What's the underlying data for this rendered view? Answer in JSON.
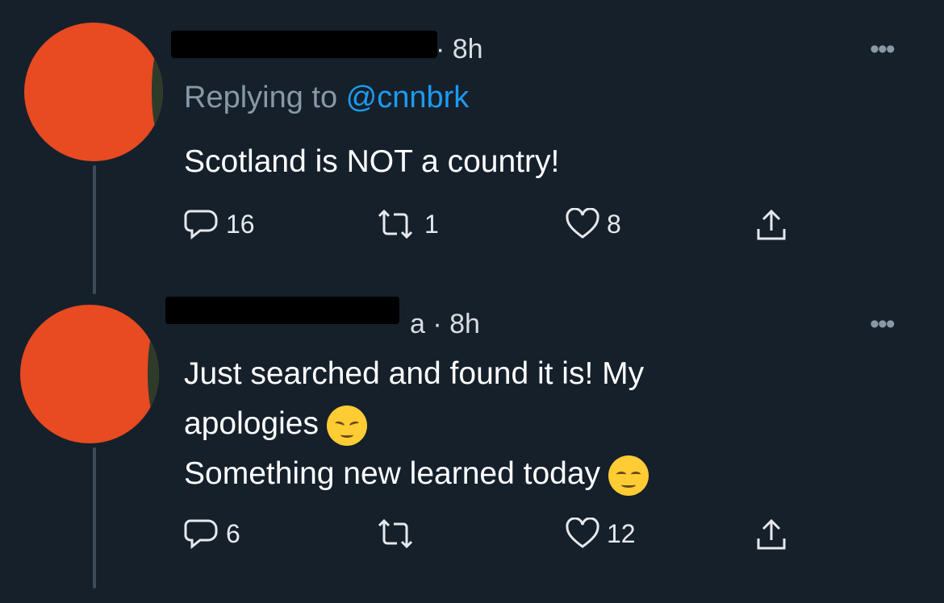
{
  "tweets": [
    {
      "time": "· 8h",
      "replying_prefix": "Replying to ",
      "replying_handle": "@cnnbrk",
      "text_lines": [
        "Scotland is NOT a country!"
      ],
      "reply_count": "16",
      "retweet_count": "1",
      "like_count": "8",
      "more": "•••"
    },
    {
      "time": "a · 8h",
      "text_lines": [
        "Just searched and found it is! My",
        "apologies",
        "Something new learned today"
      ],
      "emojis": [
        "pensive-face",
        "relieved-face"
      ],
      "reply_count": "6",
      "retweet_count": "",
      "like_count": "12",
      "more": "•••"
    }
  ],
  "colors": {
    "background": "#15202b",
    "link": "#1d9bf0",
    "muted": "#8899a6",
    "avatar_redaction": "#e84a21"
  }
}
